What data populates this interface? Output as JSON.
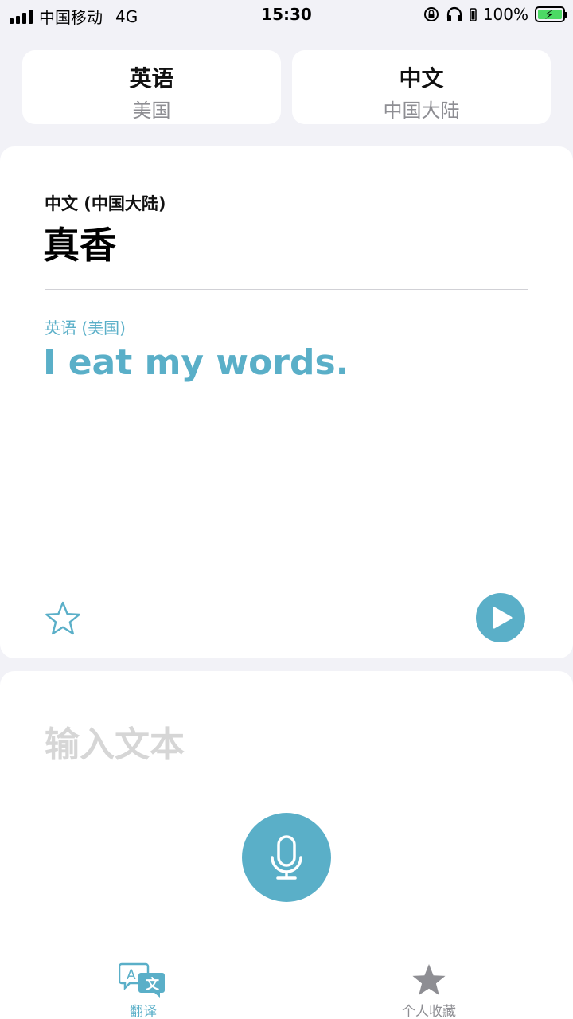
{
  "status_bar": {
    "carrier": "中国移动",
    "network": "4G",
    "time": "15:30",
    "battery": "100%"
  },
  "languages": {
    "left": {
      "name": "英语",
      "region": "美国"
    },
    "right": {
      "name": "中文",
      "region": "中国大陆"
    }
  },
  "result": {
    "source_label": "中文 (中国大陆)",
    "source_text": "真香",
    "target_label": "英语 (美国)",
    "target_text": "I eat my words."
  },
  "input": {
    "placeholder": "输入文本"
  },
  "tabs": [
    {
      "label": "翻译",
      "icon": "translate-icon",
      "active": true
    },
    {
      "label": "个人收藏",
      "icon": "star-filled-icon",
      "active": false
    }
  ],
  "colors": {
    "accent": "#5aafc8",
    "background": "#f2f2f7",
    "inactive": "#8e8e93",
    "placeholder": "#d6d6d6"
  }
}
